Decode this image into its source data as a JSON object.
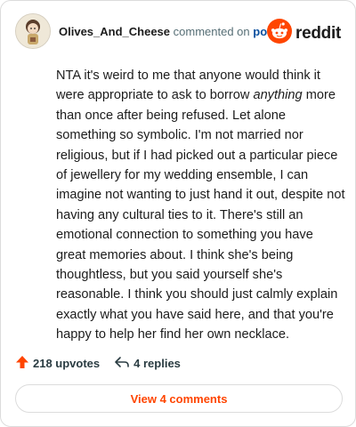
{
  "comment": {
    "username": "Olives_And_Cheese",
    "commented_text": "commented on",
    "post_link": "post",
    "body_before": "NTA it's weird to me that anyone would think it were appropriate to ask to borrow ",
    "body_emphasis": "anything",
    "body_after": " more than once after being refused. Let alone something so symbolic. I'm not married nor religious, but if I had picked out a particular piece of jewellery for my wedding ensemble, I can imagine not wanting to just hand it out, despite not having any cultural ties to it. There's still an emotional connection to something you have great memories about. I think she's being thoughtless, but you said yourself she's reasonable. I think you should just calmly explain exactly what you have said here, and that you're happy to help her find her own necklace."
  },
  "brand": {
    "name": "reddit",
    "icon": "reddit-snoo-icon",
    "color": "#ff4500"
  },
  "footer": {
    "upvotes": "218 upvotes",
    "upvote_icon": "upvote-arrow-icon",
    "replies": "4 replies",
    "reply_icon": "reply-arrow-icon",
    "view_comments": "View 4 comments"
  },
  "colors": {
    "accent": "#ff4500",
    "link": "#0a4f9e",
    "muted": "#576f76"
  }
}
